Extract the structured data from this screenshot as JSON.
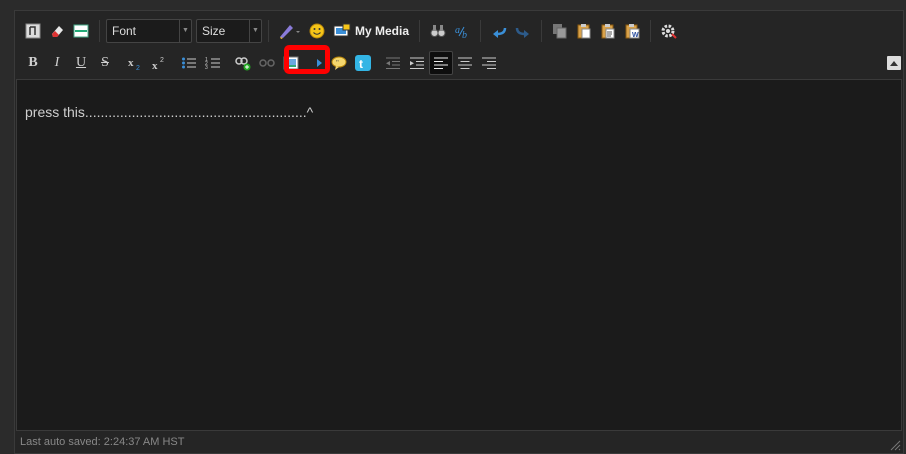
{
  "toolbar1": {
    "font_combo": {
      "label": "Font"
    },
    "size_combo": {
      "label": "Size"
    },
    "my_media_label": "My Media"
  },
  "toolbar2": {
    "bold_label": "B",
    "italic_label": "I",
    "underline_label": "U",
    "strike_label": "S"
  },
  "content": {
    "text": "press this.........................................................^"
  },
  "status": {
    "text": "Last auto saved: 2:24:37 AM HST"
  },
  "colors": {
    "highlight": "#ff0000",
    "link_blue": "#3a8fd8"
  }
}
